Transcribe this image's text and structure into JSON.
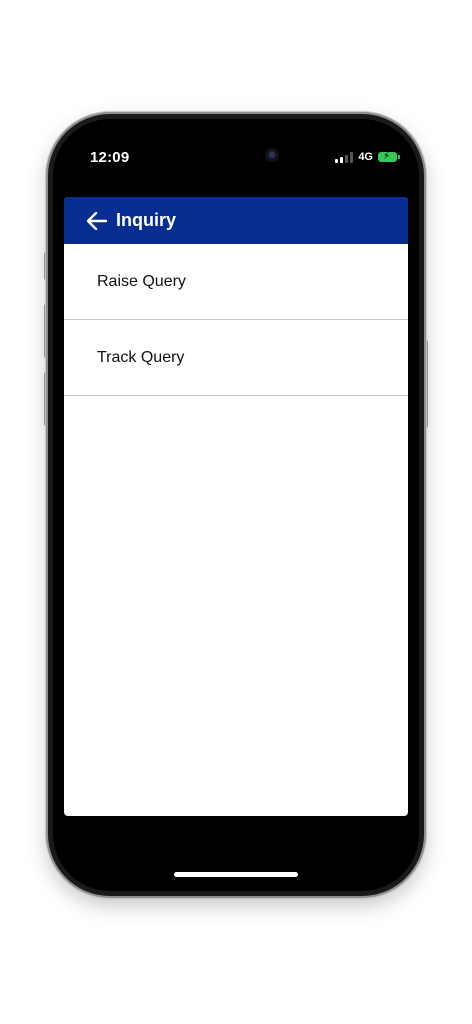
{
  "status_bar": {
    "time": "12:09",
    "network": "4G",
    "signal_bars_active": 2,
    "battery_color": "#34c759"
  },
  "app_bar": {
    "title": "Inquiry",
    "back_icon": "arrow-left-icon",
    "background_color": "#062d92"
  },
  "menu": {
    "items": [
      {
        "label": "Raise Query"
      },
      {
        "label": "Track Query"
      }
    ]
  }
}
